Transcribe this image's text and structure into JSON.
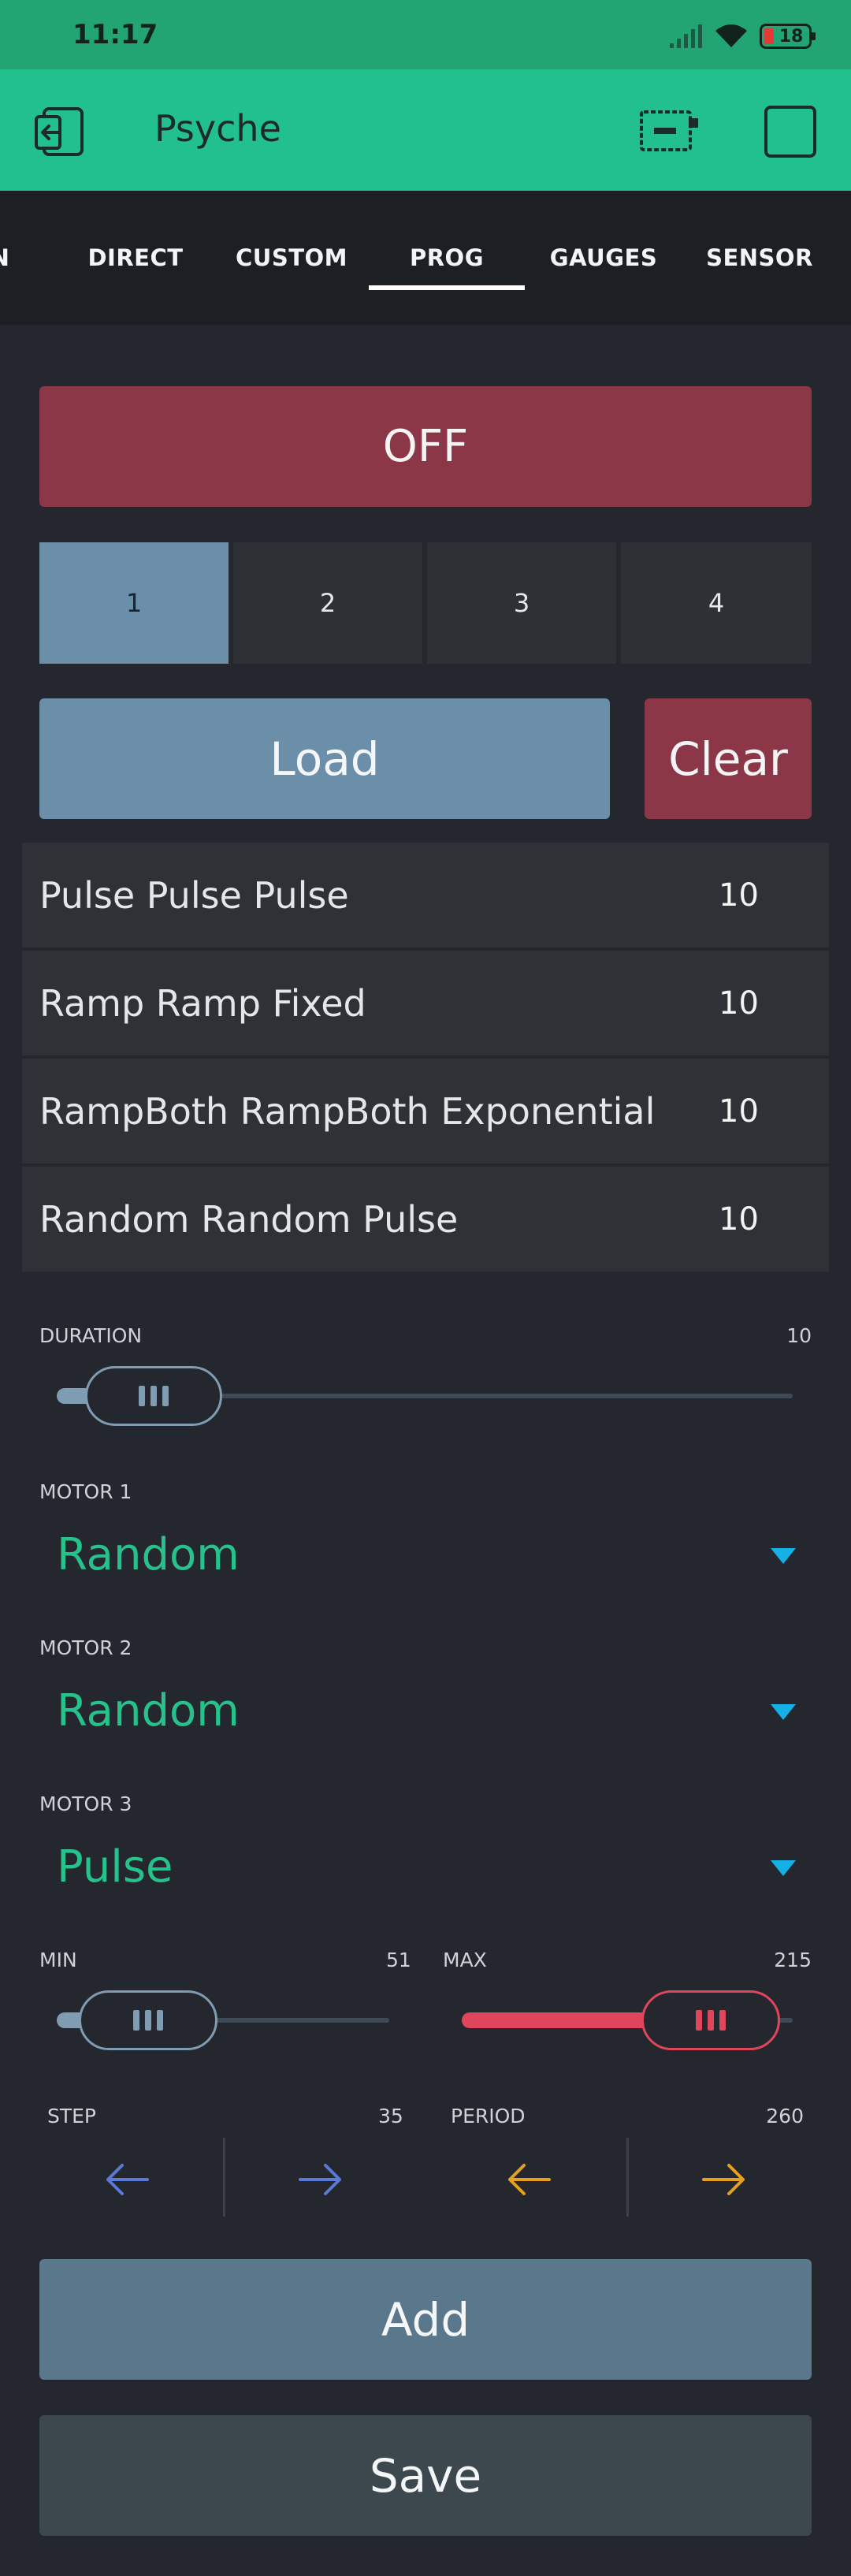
{
  "status_bar": {
    "time": "11:17",
    "battery": "18"
  },
  "app_bar": {
    "title": "Psyche"
  },
  "tabs": [
    {
      "label": "N"
    },
    {
      "label": "DIRECT"
    },
    {
      "label": "CUSTOM"
    },
    {
      "label": "PROG",
      "active": true
    },
    {
      "label": "GAUGES"
    },
    {
      "label": "SENSOR"
    }
  ],
  "power_button": {
    "label": "OFF",
    "color": "#8b3748"
  },
  "segments": [
    "1",
    "2",
    "3",
    "4"
  ],
  "selected_segment": "1",
  "load_button": "Load",
  "clear_button": "Clear",
  "programs": [
    {
      "name": "Pulse Pulse Pulse",
      "value": "10"
    },
    {
      "name": "Ramp Ramp Fixed",
      "value": "10"
    },
    {
      "name": "RampBoth RampBoth Exponential",
      "value": "10"
    },
    {
      "name": "Random Random Pulse",
      "value": "10"
    }
  ],
  "duration": {
    "label": "DURATION",
    "value": "10",
    "level": 0.02
  },
  "motor1": {
    "label": "MOTOR 1",
    "value": "Random"
  },
  "motor2": {
    "label": "MOTOR 2",
    "value": "Random"
  },
  "motor3": {
    "label": "MOTOR 3",
    "value": "Pulse"
  },
  "min": {
    "label": "MIN",
    "value": "51",
    "level": 0.2
  },
  "max": {
    "label": "MAX",
    "value": "215",
    "level": 0.84
  },
  "step": {
    "label": "STEP",
    "value": "35"
  },
  "period": {
    "label": "PERIOD",
    "value": "260"
  },
  "add_button": "Add",
  "save_button": "Save",
  "colors": {
    "accent": "#22c08c",
    "danger": "#8b3748",
    "primary": "#6b8fa9",
    "dropdown_text": "#27c28c",
    "dropdown_arrow": "#14b0e6",
    "step_arrow": "#5b79d6",
    "period_arrow": "#e5a020",
    "max_fill": "#e0465b"
  }
}
